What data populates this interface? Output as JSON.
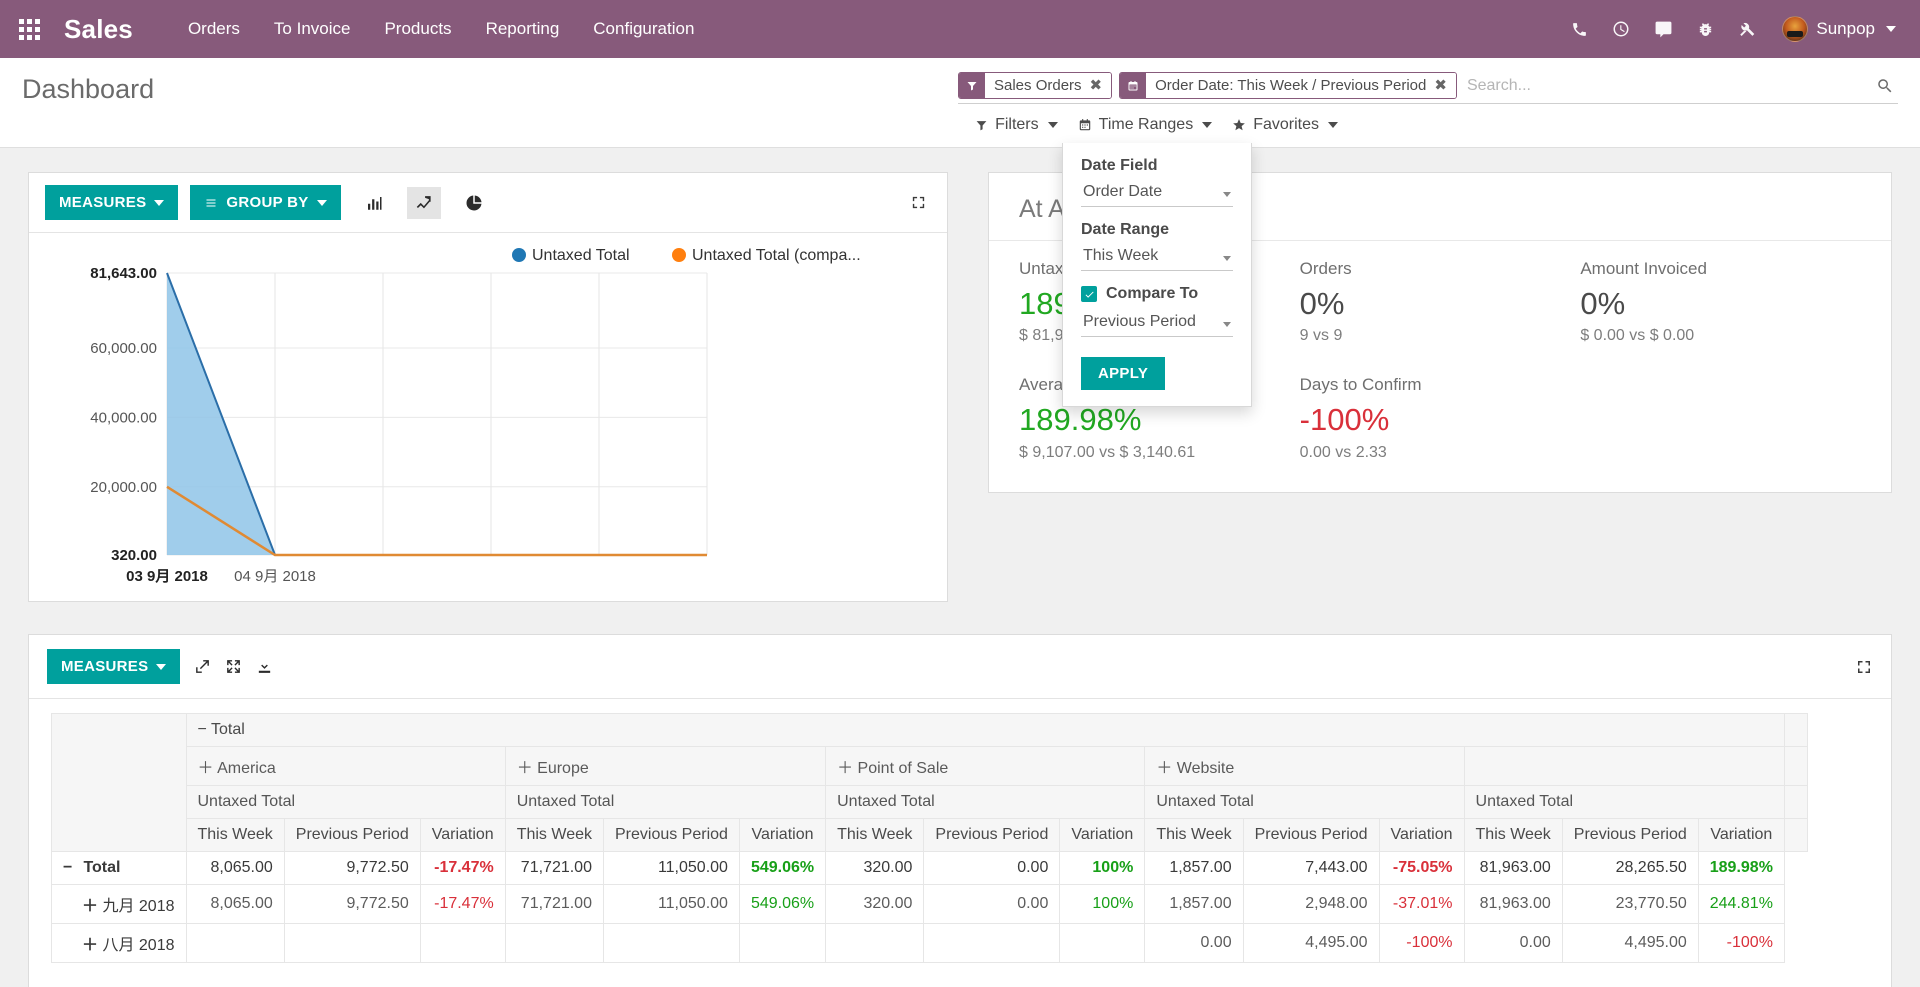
{
  "navbar": {
    "apps_icon": "apps-grid-icon",
    "brand": "Sales",
    "menu": [
      "Orders",
      "To Invoice",
      "Products",
      "Reporting",
      "Configuration"
    ],
    "icons": [
      "phone-icon",
      "clock-icon",
      "chat-icon",
      "bug-icon",
      "tools-icon"
    ],
    "user": "Sunpop",
    "brand_color": "#875A7B"
  },
  "control_panel": {
    "title": "Dashboard",
    "facets": [
      {
        "icon": "filter-icon",
        "label": "Sales Orders",
        "close": "✖"
      },
      {
        "icon": "calendar-icon",
        "label": "Order Date: This Week / Previous Period",
        "close": "✖"
      }
    ],
    "search_placeholder": "Search...",
    "buttons": [
      {
        "icon": "filter-icon",
        "label": "Filters",
        "caret": true
      },
      {
        "icon": "calendar-icon",
        "label": "Time Ranges",
        "caret": true
      },
      {
        "icon": "star-icon",
        "label": "Favorites",
        "caret": true
      }
    ]
  },
  "time_ranges_dropdown": {
    "date_field_label": "Date Field",
    "date_field_value": "Order Date",
    "date_range_label": "Date Range",
    "date_range_value": "This Week",
    "compare_to_label": "Compare To",
    "compare_to_checked": true,
    "compare_to_value": "Previous Period",
    "apply_label": "APPLY",
    "accent": "#00A09D"
  },
  "graph": {
    "measures_label": "MEASURES",
    "group_by_label": "GROUP BY",
    "view_toggles": [
      "bar-chart-icon",
      "line-chart-icon",
      "pie-chart-icon"
    ],
    "active_view": "line-chart-icon",
    "expand_icon": "expand-icon"
  },
  "chart_data": {
    "type": "area",
    "title": "",
    "xlabel": "",
    "ylabel": "",
    "x": [
      "03 9月 2018",
      "04 9月 2018",
      "",
      "",
      "",
      ""
    ],
    "ytick_labels": [
      "81,643.00",
      "60,000.00",
      "40,000.00",
      "20,000.00",
      "320.00"
    ],
    "ytick_values": [
      81643,
      60000,
      40000,
      20000,
      320
    ],
    "ylim": [
      320,
      81643
    ],
    "grid": true,
    "legend_position": "top",
    "series": [
      {
        "name": "Untaxed Total",
        "color": "#1f77b4",
        "values": [
          81643,
          320,
          320,
          320,
          320,
          320
        ]
      },
      {
        "name": "Untaxed Total (compa...",
        "color": "#ff7f0e",
        "values": [
          20000,
          320,
          320,
          320,
          320,
          320
        ]
      }
    ]
  },
  "stats": {
    "title": "At A Glance",
    "cells": [
      {
        "label": "Untaxed Total",
        "value": "189.98%",
        "trend": "up",
        "sub": "$ 81,963.00 vs $ 28,265.50"
      },
      {
        "label": "Orders",
        "value": "0%",
        "trend": "flat",
        "sub": "9 vs 9"
      },
      {
        "label": "Amount Invoiced",
        "value": "0%",
        "trend": "flat",
        "sub": "$ 0.00 vs $ 0.00"
      },
      {
        "label": "Average Untaxed Total",
        "value": "189.98%",
        "trend": "up",
        "sub": "$ 9,107.00 vs $ 3,140.61"
      },
      {
        "label": "Days to Confirm",
        "value": "-100%",
        "trend": "down",
        "sub": "0.00 vs 2.33"
      }
    ]
  },
  "pivot": {
    "measures_label": "MEASURES",
    "toolbar_icons": [
      "expand-icon",
      "expand-all-icon",
      "download-xls-icon",
      "fullscreen-icon"
    ],
    "col_root": {
      "toggle": "−",
      "label": "Total"
    },
    "col_groups": [
      {
        "toggle": "＋",
        "label": "America",
        "measure": "Untaxed Total"
      },
      {
        "toggle": "＋",
        "label": "Europe",
        "measure": "Untaxed Total"
      },
      {
        "toggle": "＋",
        "label": "Point of Sale",
        "measure": "Untaxed Total"
      },
      {
        "toggle": "＋",
        "label": "Website",
        "measure": "Untaxed Total"
      },
      {
        "toggle": "",
        "label": "",
        "measure": "Untaxed Total"
      }
    ],
    "sub_headers": [
      "This Week",
      "Previous Period",
      "Variation"
    ],
    "rows": [
      {
        "toggle": "−",
        "label": "Total",
        "level": 0,
        "is_total": true,
        "cells": [
          "8,065.00",
          "9,772.50",
          "-17.47%",
          "71,721.00",
          "11,050.00",
          "549.06%",
          "320.00",
          "0.00",
          "100%",
          "1,857.00",
          "7,443.00",
          "-75.05%",
          "81,963.00",
          "28,265.50",
          "189.98%"
        ]
      },
      {
        "toggle": "＋",
        "label": "九月 2018",
        "level": 1,
        "is_total": false,
        "cells": [
          "8,065.00",
          "9,772.50",
          "-17.47%",
          "71,721.00",
          "11,050.00",
          "549.06%",
          "320.00",
          "0.00",
          "100%",
          "1,857.00",
          "2,948.00",
          "-37.01%",
          "81,963.00",
          "23,770.50",
          "244.81%"
        ]
      },
      {
        "toggle": "＋",
        "label": "八月 2018",
        "level": 1,
        "is_total": false,
        "cells": [
          "",
          "",
          "",
          "",
          "",
          "",
          "",
          "",
          "",
          "0.00",
          "4,495.00",
          "-100%",
          "0.00",
          "4,495.00",
          "-100%"
        ]
      }
    ]
  }
}
